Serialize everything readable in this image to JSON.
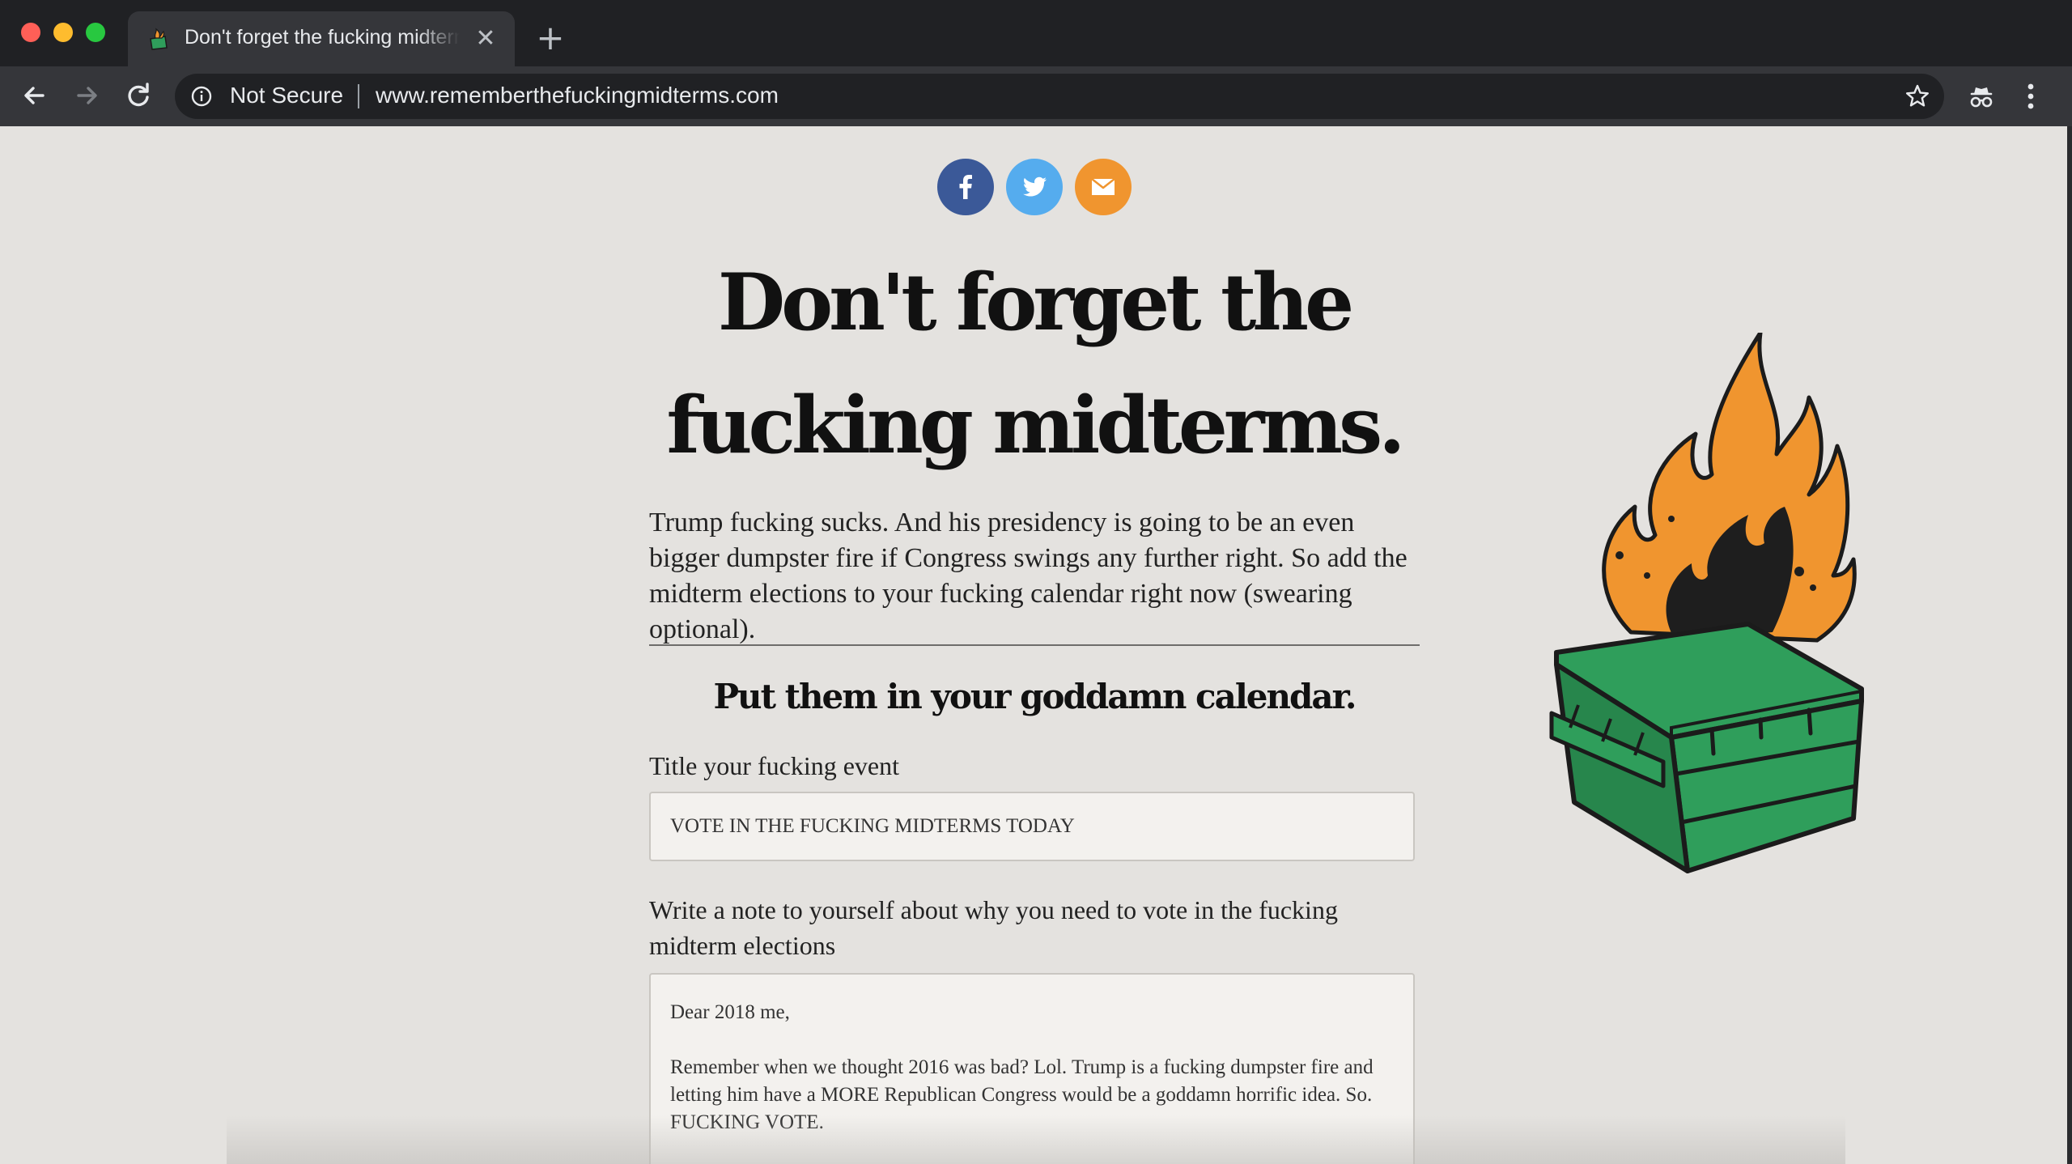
{
  "browser": {
    "tab": {
      "title": "Don't forget the fucking midterms.",
      "close_label": "✕",
      "favicon": "dumpster-fire-icon"
    },
    "new_tab_label": "+",
    "toolbar": {
      "back_icon": "arrow-left-icon",
      "forward_icon": "arrow-right-icon",
      "reload_icon": "reload-icon"
    },
    "omnibox": {
      "security_label": "Not Secure",
      "url": "www.rememberthefuckingmidterms.com",
      "bookmark_icon": "star-icon"
    },
    "incognito_icon": "incognito-icon",
    "menu_icon": "kebab-menu-icon"
  },
  "page": {
    "share": [
      {
        "network": "facebook",
        "icon": "facebook-icon",
        "color": "#3b5998"
      },
      {
        "network": "twitter",
        "icon": "twitter-icon",
        "color": "#55acee"
      },
      {
        "network": "email",
        "icon": "envelope-icon",
        "color": "#f0952f"
      }
    ],
    "headline": "Don't forget the fucking midterms.",
    "intro": "Trump fucking sucks. And his presidency is going to be an even bigger dumpster fire if Congress swings any further right. So add the midterm elections to your fucking calendar right now (swearing optional).",
    "form": {
      "heading": "Put them in your goddamn calendar.",
      "title_label": "Title your fucking event",
      "title_value": "VOTE IN THE FUCKING MIDTERMS TODAY",
      "note_label": "Write a note to yourself about why you need to vote in the fucking midterm elections",
      "note_value": "Dear 2018 me,\n\nRemember when we thought 2016 was bad? Lol. Trump is a fucking dumpster fire and letting him have a MORE Republican Congress would be a goddamn horrific idea. So. FUCKING VOTE."
    },
    "illustration": "dumpster-fire-illustration",
    "colors": {
      "background": "#e4e2df",
      "dumpster_green": "#2f9e5b",
      "flame_orange": "#f0952f"
    }
  }
}
